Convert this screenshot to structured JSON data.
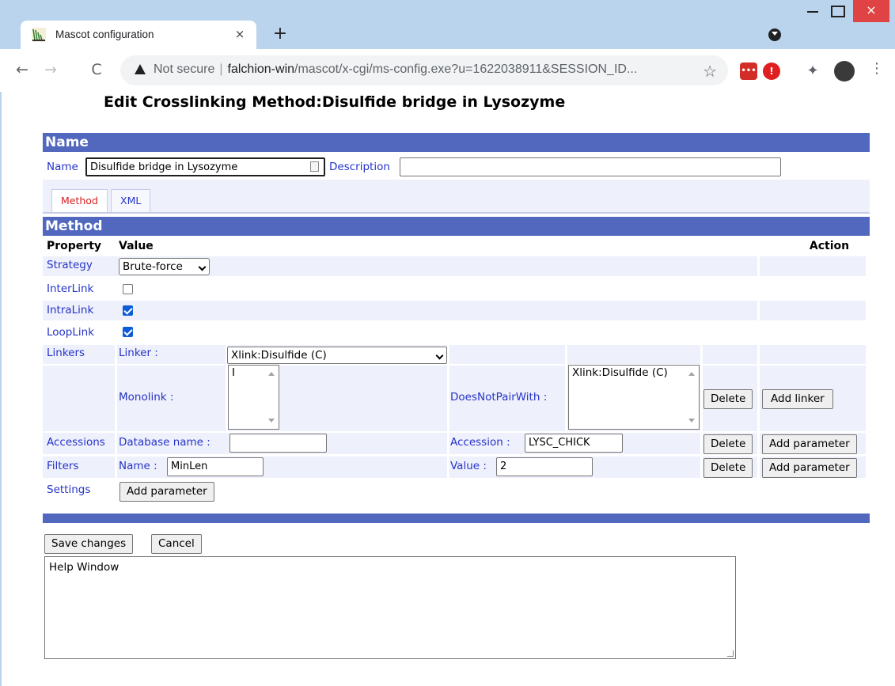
{
  "browser": {
    "tab_title": "Mascot configuration",
    "close_tab": "×",
    "new_tab": "+",
    "security_label": "Not secure",
    "url_host": "falchion-win",
    "url_path": "/mascot/x-cgi/ms-config.exe?u=1622038911&SESSION_ID...",
    "bookmark": "☆",
    "win_close": "×",
    "back": "←",
    "forward": "→",
    "reload": "C",
    "menu": "⋮"
  },
  "page": {
    "title": "Edit Crosslinking Method:Disulfide bridge in Lysozyme"
  },
  "name_section": {
    "header": "Name",
    "name_label": "Name",
    "name_value": "Disulfide bridge in Lysozyme",
    "description_label": "Description",
    "description_value": ""
  },
  "tabs": [
    "Method",
    "XML"
  ],
  "method_section": {
    "header": "Method",
    "col_property": "Property",
    "col_value": "Value",
    "col_action": "Action",
    "strategy": {
      "label": "Strategy",
      "value": "Brute-force"
    },
    "interlink": {
      "label": "InterLink",
      "checked": false
    },
    "intralink": {
      "label": "IntraLink",
      "checked": true
    },
    "looplink": {
      "label": "LoopLink",
      "checked": true
    },
    "linkers": {
      "label": "Linkers",
      "linker_label": "Linker :",
      "linker_value": "Xlink:Disulfide (C)",
      "monolink_label": "Monolink :",
      "monolink_value": "I",
      "doesnotpair_label": "DoesNotPairWith :",
      "doesnotpair_value": "Xlink:Disulfide (C)",
      "delete": "Delete",
      "add": "Add linker"
    },
    "accessions": {
      "label": "Accessions",
      "db_label": "Database name :",
      "db_value": "",
      "accession_label": "Accession :",
      "accession_value": "LYSC_CHICK",
      "delete": "Delete",
      "add": "Add parameter"
    },
    "filters": {
      "label": "Filters",
      "name_label": "Name :",
      "name_value": "MinLen",
      "value_label": "Value :",
      "value_value": "2",
      "delete": "Delete",
      "add": "Add parameter"
    },
    "settings": {
      "label": "Settings",
      "add": "Add parameter"
    }
  },
  "actions": {
    "save": "Save changes",
    "cancel": "Cancel"
  },
  "help": {
    "text": "Help Window"
  }
}
